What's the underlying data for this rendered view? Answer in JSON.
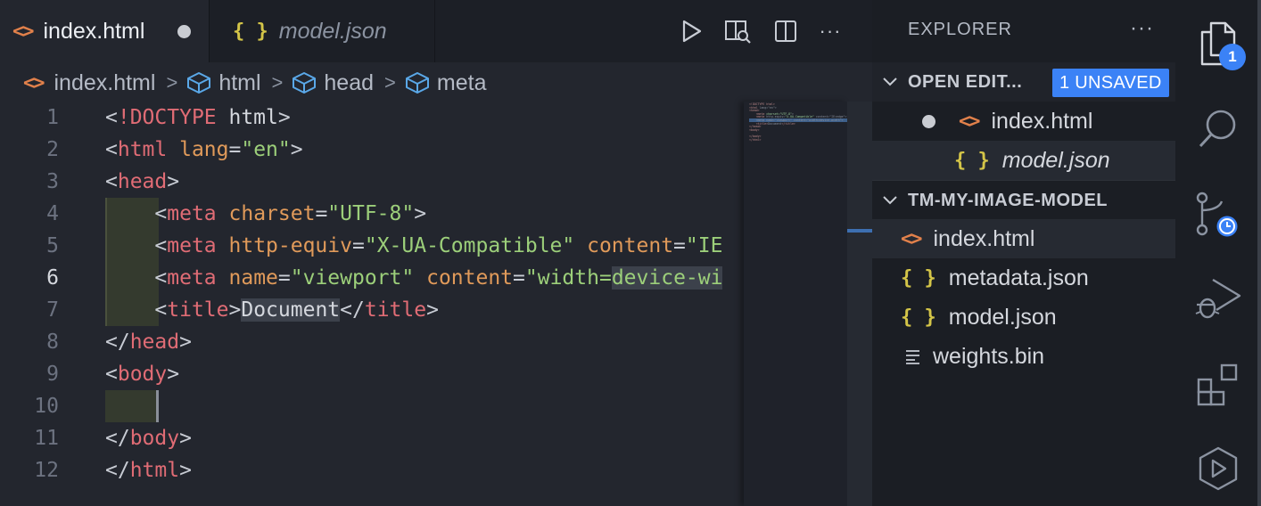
{
  "tabs": [
    {
      "label": "index.html",
      "icon": "html-file-icon",
      "unsaved": true
    },
    {
      "label": "model.json",
      "icon": "json-file-icon",
      "preview": true
    }
  ],
  "breadcrumb": [
    "index.html",
    "html",
    "head",
    "meta"
  ],
  "editor": {
    "active_line": 6,
    "line_numbers": [
      "1",
      "2",
      "3",
      "4",
      "5",
      "6",
      "7",
      "8",
      "9",
      "10",
      "11",
      "12"
    ]
  },
  "explorer": {
    "title": "EXPLORER",
    "more": "···",
    "open_editors": {
      "label": "OPEN EDIT...",
      "badge": "1 UNSAVED",
      "files": [
        {
          "name": "index.html",
          "icon": "html-file-icon"
        },
        {
          "name": "model.json",
          "icon": "json-file-icon"
        }
      ]
    },
    "folder": {
      "label": "TM-MY-IMAGE-MODEL",
      "files": [
        {
          "name": "index.html",
          "icon": "html-file-icon"
        },
        {
          "name": "metadata.json",
          "icon": "json-file-icon"
        },
        {
          "name": "model.json",
          "icon": "json-file-icon"
        },
        {
          "name": "weights.bin",
          "icon": "text-file-icon"
        }
      ]
    }
  },
  "activity_bar": {
    "explorer_badge": "1",
    "items": [
      "files-icon",
      "search-icon",
      "source-control-icon",
      "run-debug-icon",
      "extensions-icon",
      "remote-icon"
    ]
  },
  "colors": {
    "accent": "#3b82f6",
    "tag": "#e06c75",
    "attr": "#e09a5a",
    "string": "#9ccf7a",
    "html_icon": "#e2814b",
    "json_icon": "#d4c548"
  }
}
